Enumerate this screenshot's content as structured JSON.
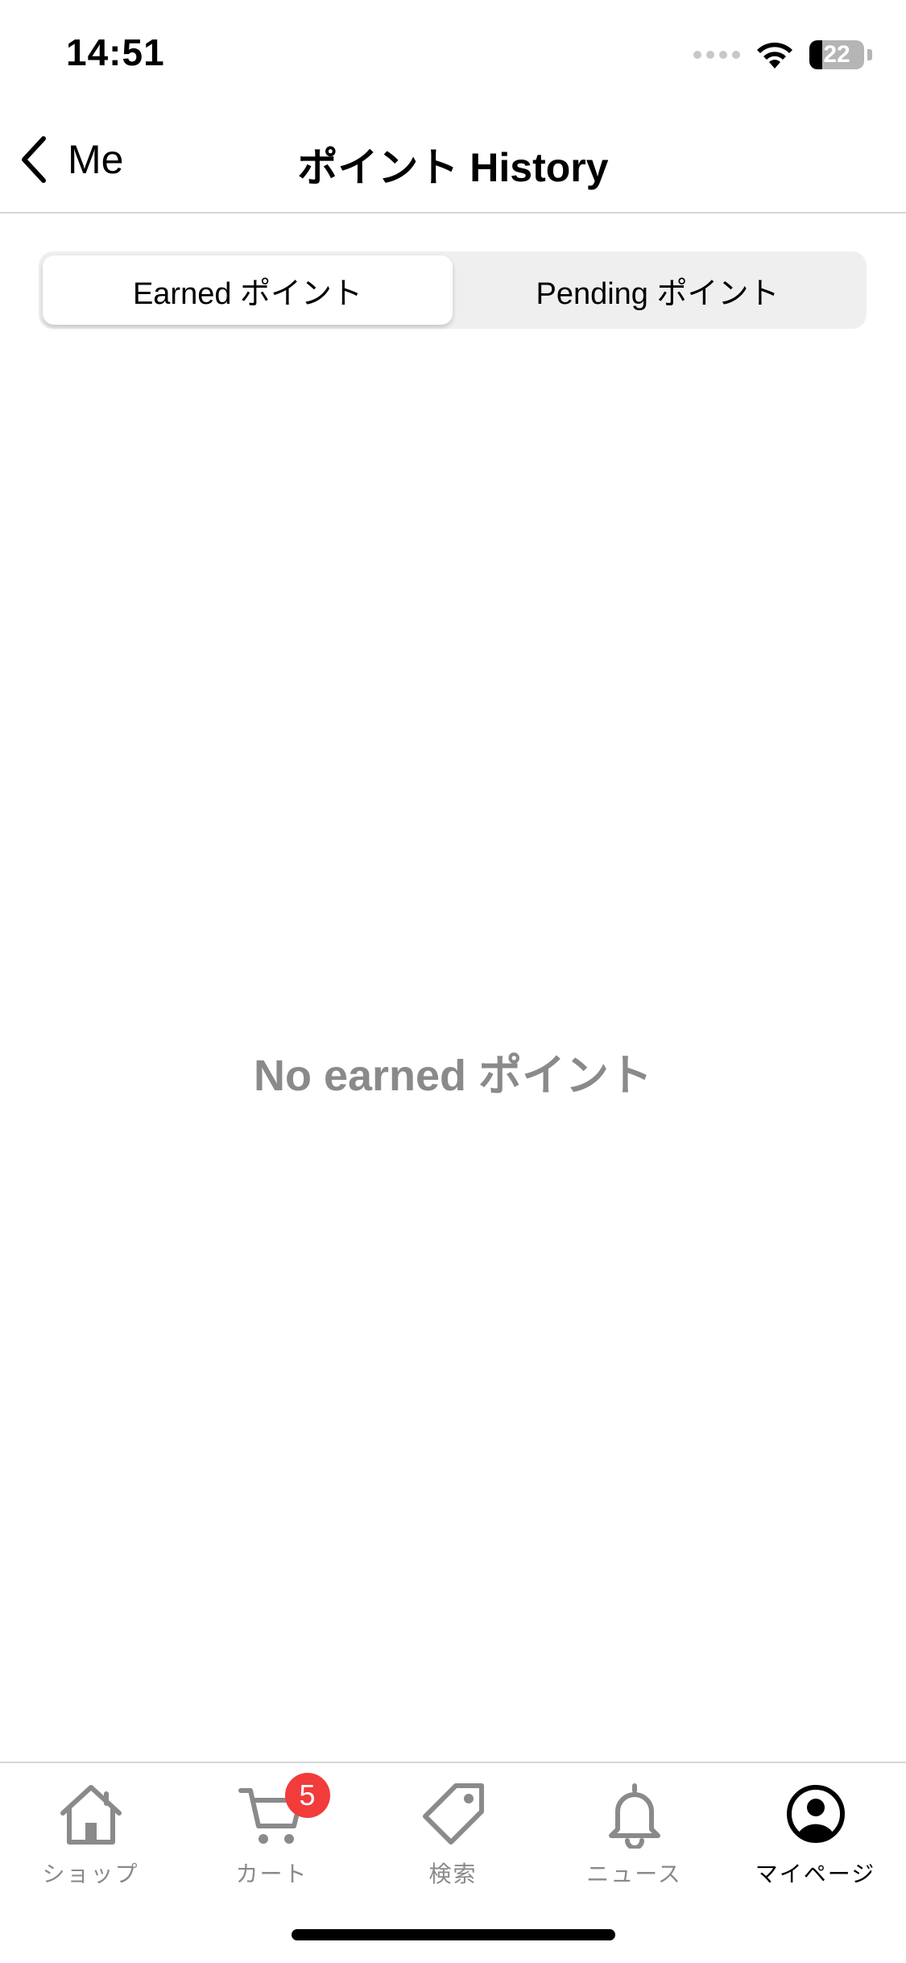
{
  "status_bar": {
    "time": "14:51",
    "battery_level": "22"
  },
  "nav": {
    "back_label": "Me",
    "title": "ポイント History"
  },
  "segments": [
    {
      "label": "Earned ポイント",
      "selected": true
    },
    {
      "label": "Pending ポイント",
      "selected": false
    }
  ],
  "empty_state": {
    "message": "No earned ポイント"
  },
  "tab_bar": {
    "items": [
      {
        "label": "ショップ",
        "icon": "home-icon",
        "active": false
      },
      {
        "label": "カート",
        "icon": "cart-icon",
        "active": false,
        "badge": "5"
      },
      {
        "label": "検索",
        "icon": "tag-icon",
        "active": false
      },
      {
        "label": "ニュース",
        "icon": "bell-icon",
        "active": false
      },
      {
        "label": "マイページ",
        "icon": "profile-icon",
        "active": true
      }
    ]
  },
  "colors": {
    "badge": "#f23b3b",
    "inactive_label": "#8a8a8a",
    "segment_background": "#efefef"
  }
}
